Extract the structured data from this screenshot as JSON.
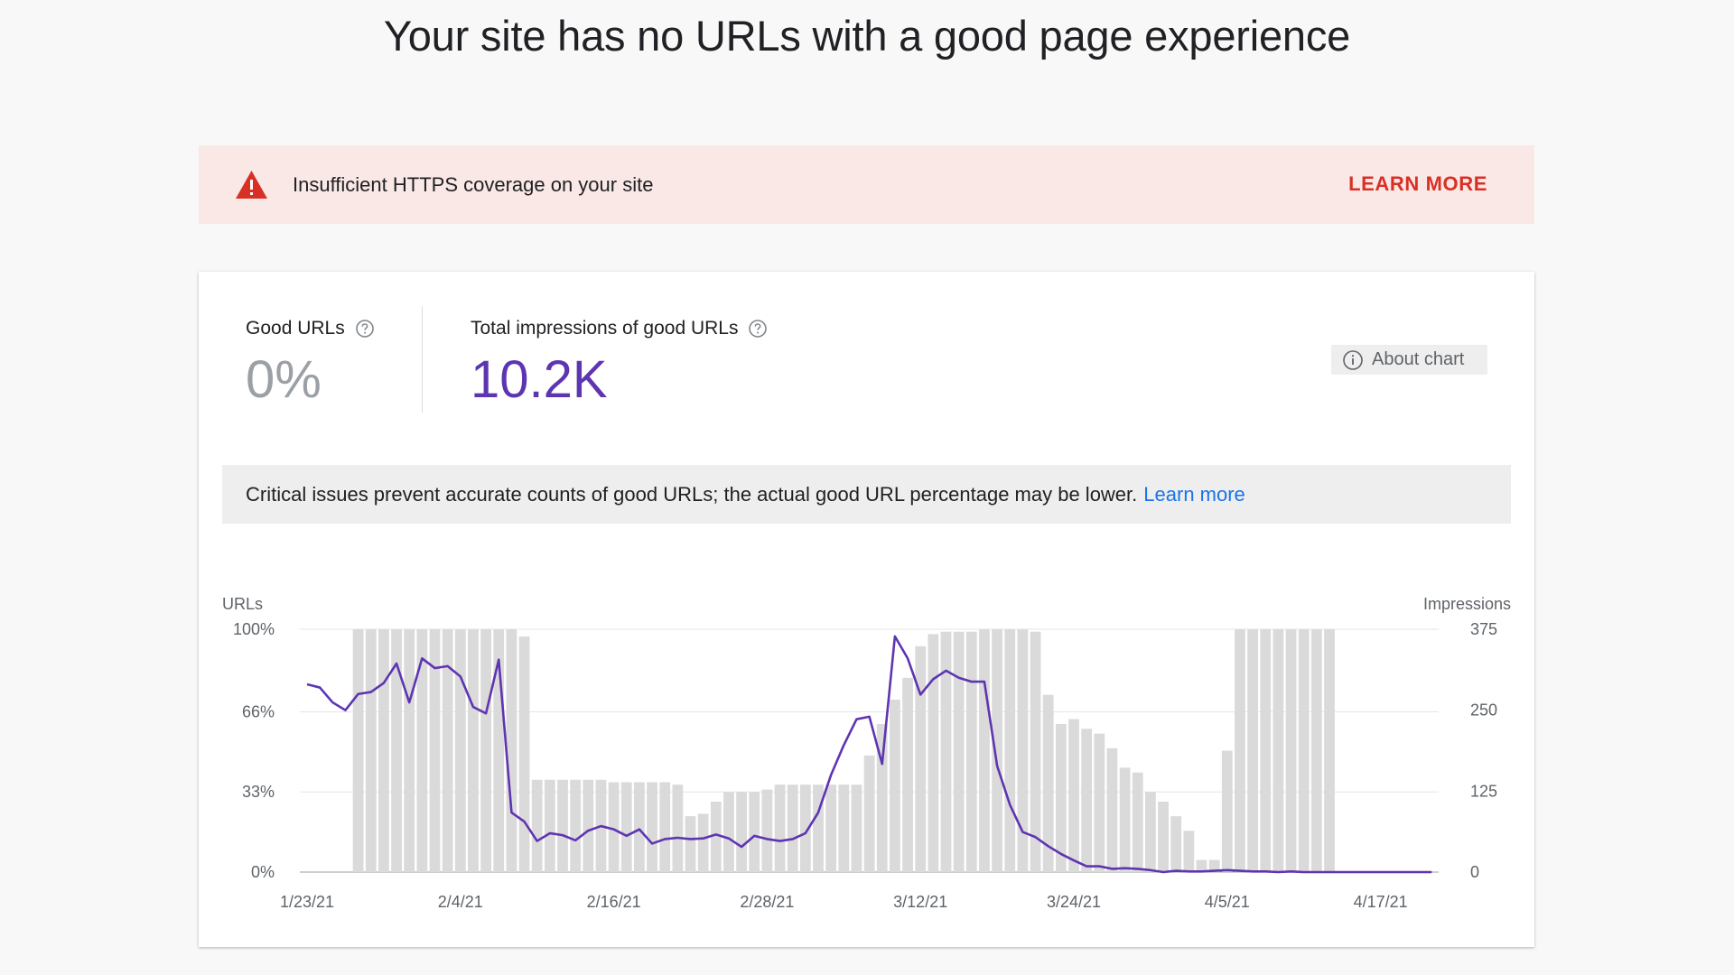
{
  "page": {
    "title": "Your site has no URLs with a good page experience"
  },
  "banner": {
    "icon": "warning-triangle-icon",
    "text": "Insufficient HTTPS coverage on your site",
    "action": "LEARN MORE",
    "background": "#fae8e6",
    "accent": "#d93025"
  },
  "summary": {
    "good_urls_label": "Good URLs",
    "good_urls_value": "0%",
    "impressions_label": "Total impressions of good URLs",
    "impressions_value": "10.2K",
    "about_chart_label": "About chart"
  },
  "notice": {
    "text": "Critical issues prevent accurate counts of good URLs; the actual good URL percentage may be lower.",
    "link": "Learn more"
  },
  "chart_data": {
    "type": "bar",
    "ylabel_left": "URLs",
    "ylabel_right": "Impressions",
    "left_ticks": [
      "100%",
      "66%",
      "33%",
      "0%"
    ],
    "left_tick_values": [
      100,
      66,
      33,
      0
    ],
    "right_ticks": [
      "375",
      "250",
      "125",
      "0"
    ],
    "right_tick_values": [
      375,
      250,
      125,
      0
    ],
    "x_tick_labels": [
      "1/23/21",
      "2/4/21",
      "2/16/21",
      "2/28/21",
      "3/12/21",
      "3/24/21",
      "4/5/21",
      "4/17/21"
    ],
    "x_tick_days": [
      0,
      12,
      24,
      36,
      48,
      60,
      72,
      84
    ],
    "bar_color": "#dadada",
    "line_color": "#5e35b1",
    "series": [
      {
        "name": "URLs",
        "axis": "left",
        "kind": "bar",
        "values": [
          0,
          0,
          0,
          0,
          100,
          100,
          100,
          100,
          100,
          100,
          100,
          100,
          100,
          100,
          100,
          100,
          100,
          97,
          38,
          38,
          38,
          38,
          38,
          38,
          37,
          37,
          37,
          37,
          37,
          36,
          23,
          24,
          29,
          33,
          33,
          33,
          34,
          36,
          36,
          36,
          36,
          36,
          36,
          36,
          48,
          61,
          71,
          80,
          93,
          98,
          99,
          99,
          99,
          100,
          100,
          100,
          100,
          99,
          73,
          61,
          63,
          59,
          57,
          51,
          43,
          41,
          33,
          29,
          23,
          17,
          5,
          5,
          50,
          100,
          100,
          100,
          100,
          100,
          100,
          100,
          100,
          0,
          0,
          0,
          0,
          0,
          0,
          0,
          0,
          0,
          0
        ]
      },
      {
        "name": "Impressions",
        "axis": "right",
        "kind": "line",
        "values": [
          290,
          285,
          262,
          250,
          275,
          278,
          292,
          322,
          262,
          330,
          315,
          318,
          302,
          255,
          245,
          328,
          92,
          78,
          48,
          60,
          57,
          49,
          64,
          71,
          66,
          56,
          66,
          44,
          51,
          53,
          51,
          52,
          58,
          52,
          39,
          56,
          51,
          48,
          51,
          60,
          92,
          150,
          196,
          236,
          240,
          167,
          364,
          330,
          274,
          298,
          311,
          300,
          294,
          294,
          164,
          104,
          62,
          54,
          40,
          28,
          18,
          9,
          9,
          5,
          6,
          5,
          3,
          0,
          2,
          1,
          1,
          2,
          3,
          2,
          1,
          1,
          0,
          1,
          0,
          0,
          0,
          0,
          0,
          0,
          0,
          0,
          0,
          0,
          0
        ]
      }
    ],
    "ylim_left": [
      0,
      100
    ],
    "ylim_right": [
      0,
      375
    ],
    "grid": true
  }
}
